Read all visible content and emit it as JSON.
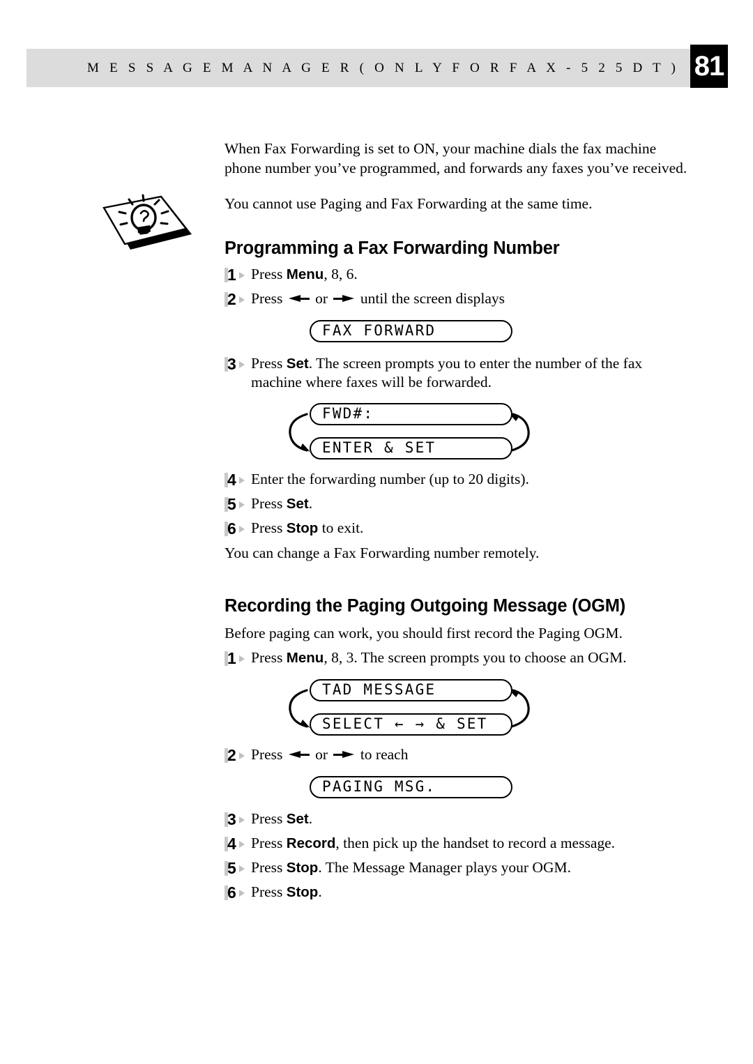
{
  "header": {
    "running_title": "M E S S A G E   M A N A G E R   ( O N L Y   F O R   F A X - 5 2 5 D T )",
    "page_number": "81"
  },
  "icons": {
    "tip": "lightbulb-note-icon",
    "left_arrow": "left-triangle-arrow-icon",
    "right_arrow": "right-triangle-arrow-icon",
    "cycle": "alternating-display-arrows-icon"
  },
  "intro": {
    "paragraph_1": "When Fax Forwarding is set to ON, your machine dials the fax machine phone number you’ve programmed, and forwards any faxes you’ve received.",
    "paragraph_2": "You cannot use Paging and Fax Forwarding at the same time."
  },
  "section_fax_forwarding": {
    "heading": "Programming a Fax Forwarding Number",
    "steps": [
      {
        "number": "1",
        "pre": "Press ",
        "bold": "Menu",
        "post": ", 8, 6."
      },
      {
        "number": "2",
        "pre": "Press ",
        "mid": " or ",
        "post": " until the screen displays"
      },
      {
        "number": "3",
        "pre": "Press ",
        "bold": "Set",
        "post": ". The screen prompts you to enter the number of the fax machine where faxes will be forwarded."
      },
      {
        "number": "4",
        "pre": "Enter the forwarding number (up to 20 digits)."
      },
      {
        "number": "5",
        "pre": "Press ",
        "bold": "Set",
        "post": "."
      },
      {
        "number": "6",
        "pre": "Press ",
        "bold": "Stop",
        "post": " to exit."
      }
    ],
    "lcd_fax_forward": "FAX FORWARD",
    "lcd_fwd_number": "FWD#:",
    "lcd_enter_set": "ENTER & SET",
    "closing_note": "You can change a Fax Forwarding number remotely."
  },
  "section_paging_ogm": {
    "heading": "Recording the Paging Outgoing Message (OGM)",
    "intro": "Before paging can work, you should first record the Paging OGM.",
    "steps": [
      {
        "number": "1",
        "pre": "Press ",
        "bold": "Menu",
        "post": ", 8, 3. The screen prompts you to choose an OGM."
      },
      {
        "number": "2",
        "pre": "Press ",
        "mid": " or ",
        "post": " to reach"
      },
      {
        "number": "3",
        "pre": "Press ",
        "bold": "Set",
        "post": "."
      },
      {
        "number": "4",
        "pre": "Press ",
        "bold": "Record",
        "post": ", then pick up the handset to record a message."
      },
      {
        "number": "5",
        "pre": "Press ",
        "bold": "Stop",
        "post": ". The Message Manager plays your OGM."
      },
      {
        "number": "6",
        "pre": "Press ",
        "bold": "Stop",
        "post": "."
      }
    ],
    "lcd_tad_message": "TAD MESSAGE",
    "lcd_select_set": "SELECT ← → & SET",
    "lcd_paging_msg": "PAGING MSG."
  },
  "colors": {
    "header_band": "#dcdcdc",
    "page_box": "#000000",
    "step_marker": "#c8c8c8",
    "text": "#000000"
  }
}
